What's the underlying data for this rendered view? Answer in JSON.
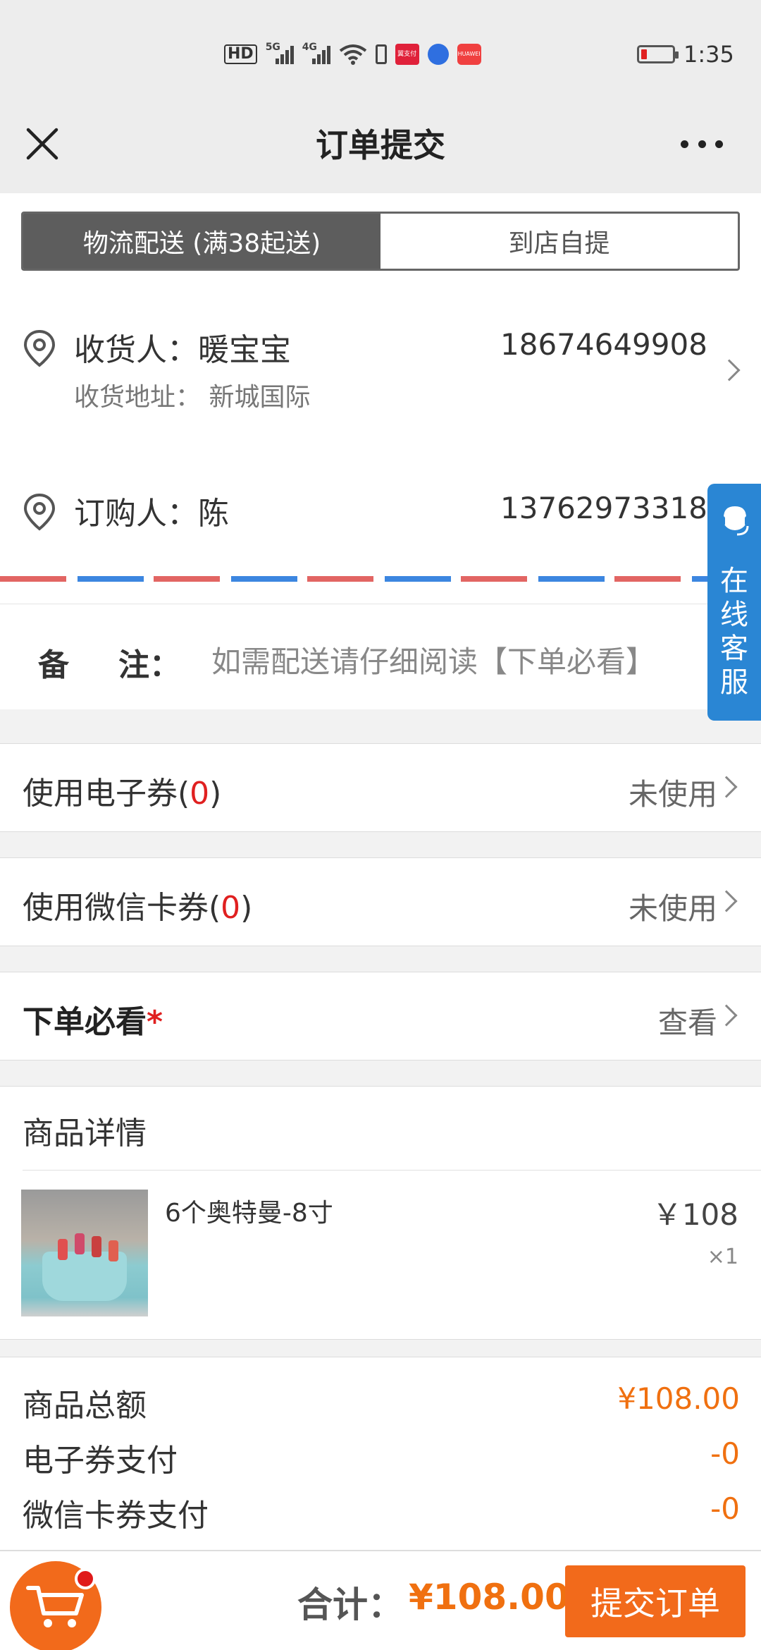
{
  "status_bar": {
    "time": "1:35",
    "hd_label": "HD",
    "sig1_label": "5G",
    "sig2_label": "4G",
    "app1_label": "翼支付",
    "app3_label": "HUAWEI"
  },
  "nav": {
    "title": "订单提交"
  },
  "delivery_tabs": {
    "logistics": "物流配送 (满38起送)",
    "pickup": "到店自提"
  },
  "receiver": {
    "label": "收货人：暖宝宝",
    "phone": "18674649908",
    "address": "收货地址：  新城国际"
  },
  "buyer": {
    "label": "订购人：陈",
    "phone": "13762973318"
  },
  "remark": {
    "label_a": "备",
    "label_b": "注：",
    "placeholder": "如需配送请仔细阅读【下单必看】"
  },
  "customer_service": {
    "label": "在线客服"
  },
  "coupon_e": {
    "label": "使用电子券(",
    "count": "0",
    "close": ")",
    "value": "未使用"
  },
  "coupon_wx": {
    "label": "使用微信卡券(",
    "count": "0",
    "close": ")",
    "value": "未使用"
  },
  "must_read": {
    "label": "下单必看",
    "required_mark": "*",
    "value": "查看"
  },
  "goods": {
    "title": "商品详情",
    "items": [
      {
        "name": "6个奥特曼-8寸",
        "price": "￥108",
        "qty": "×1"
      }
    ]
  },
  "summary": {
    "rows": [
      {
        "label": "商品总额",
        "value": "¥108.00"
      },
      {
        "label": "电子券支付",
        "value": "-0"
      },
      {
        "label": "微信卡券支付",
        "value": "-0"
      }
    ]
  },
  "bottom": {
    "total_label": "合计：",
    "total_value": "¥108.00",
    "submit": "提交订单"
  },
  "colors": {
    "accent": "#f26a1b",
    "price": "#f07010",
    "cs_blue": "#2a86d4",
    "tab_active": "#5d5d5d"
  }
}
